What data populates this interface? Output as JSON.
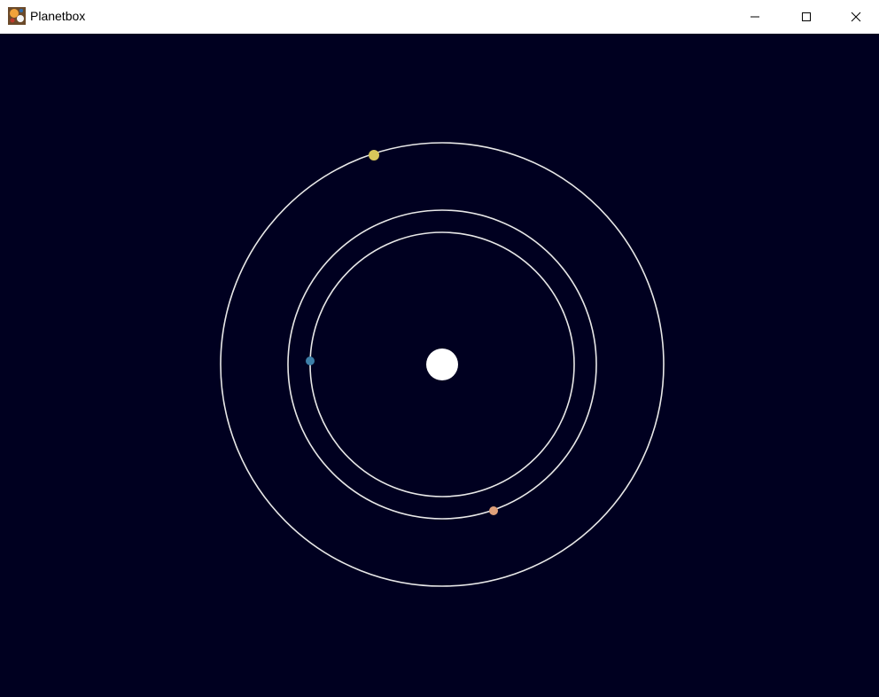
{
  "window": {
    "title": "Planetbox",
    "icon": "planetbox-app-icon",
    "controls": {
      "minimize_icon": "minimize-icon",
      "maximize_icon": "maximize-icon",
      "close_icon": "close-icon"
    }
  },
  "scene": {
    "background_color": "#000020",
    "sun_color": "#ffffff",
    "orbit_color": "#e8e8e8",
    "planets": [
      {
        "name": "planet-blue",
        "color": "#3d7fa8"
      },
      {
        "name": "planet-peach",
        "color": "#e0a07a"
      },
      {
        "name": "planet-yellow",
        "color": "#d8c85a"
      }
    ]
  }
}
